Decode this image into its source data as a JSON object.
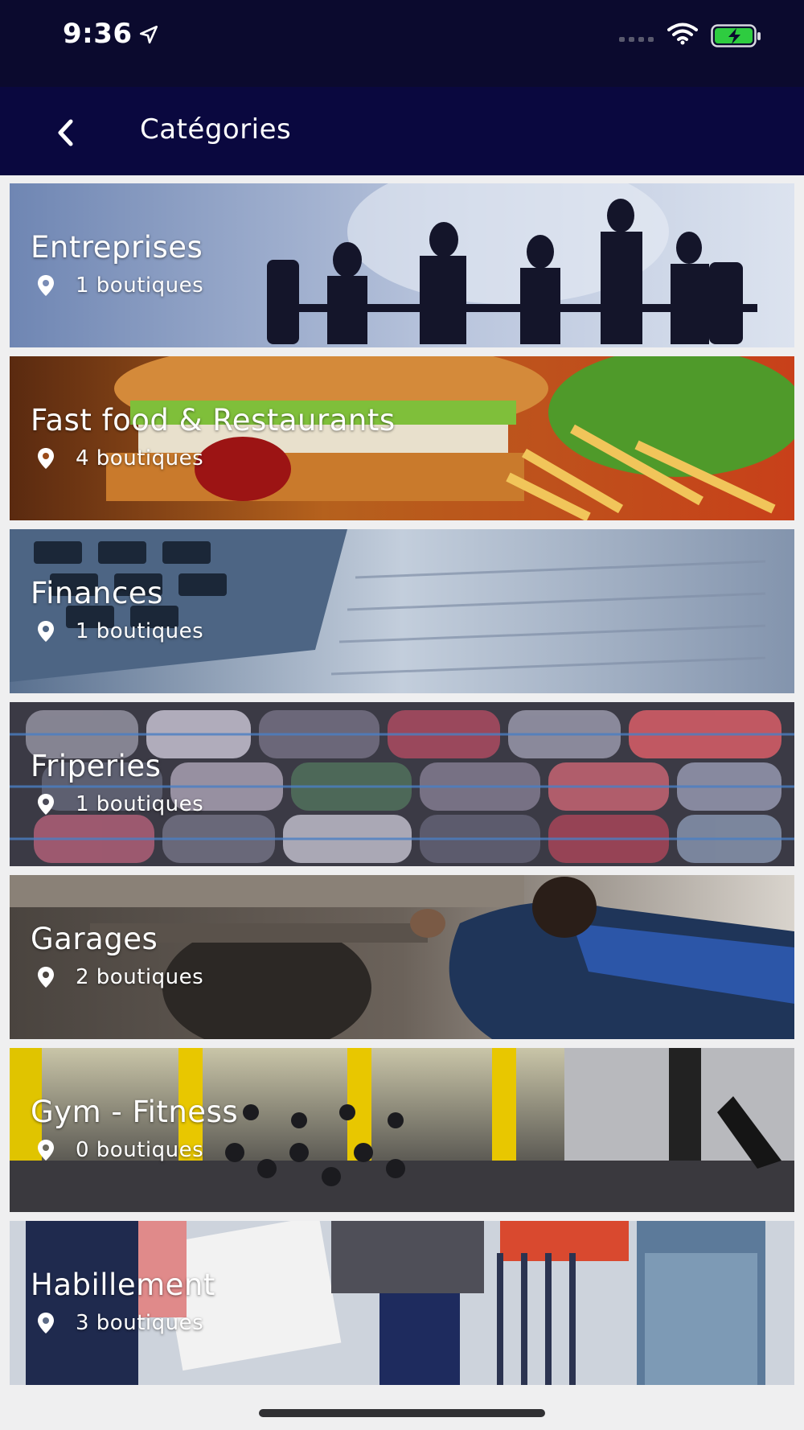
{
  "status_bar": {
    "time": "9:36",
    "icons": [
      "location-arrow-icon",
      "cellular-signal-icon",
      "wifi-icon",
      "battery-charging-icon"
    ]
  },
  "nav": {
    "back_icon": "chevron-left-icon",
    "title": "Catégories"
  },
  "colors": {
    "status_bar_bg": "#0b0a2e",
    "nav_bar_bg": "#0a083f",
    "page_bg": "#efeff0",
    "text": "#ffffff",
    "battery_fill": "#2ecc40"
  },
  "categories": [
    {
      "name": "Entreprises",
      "count": "1 boutiques",
      "icon": "map-pin-icon"
    },
    {
      "name": "Fast food & Restaurants",
      "count": "4 boutiques",
      "icon": "map-pin-icon"
    },
    {
      "name": "Finances",
      "count": "1 boutiques",
      "icon": "map-pin-icon"
    },
    {
      "name": "Friperies",
      "count": "1 boutiques",
      "icon": "map-pin-icon"
    },
    {
      "name": "Garages",
      "count": "2 boutiques",
      "icon": "map-pin-icon"
    },
    {
      "name": "Gym - Fitness",
      "count": "0 boutiques",
      "icon": "map-pin-icon"
    },
    {
      "name": "Habillement",
      "count": "3 boutiques",
      "icon": "map-pin-icon"
    }
  ]
}
